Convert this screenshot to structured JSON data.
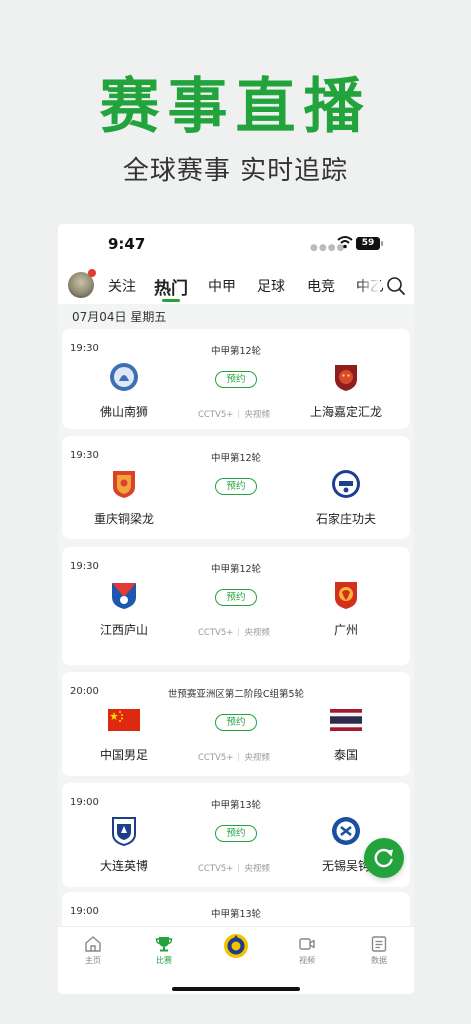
{
  "promo": {
    "title": "赛事直播",
    "subtitle": "全球赛事 实时追踪"
  },
  "status_bar": {
    "time": "9:47",
    "battery": "59"
  },
  "tabs": [
    "关注",
    "热门",
    "中甲",
    "足球",
    "电竞",
    "中乙"
  ],
  "active_tab": "热门",
  "date_header": "07月04日 星期五",
  "matches": [
    {
      "time": "19:30",
      "competition": "中甲第12轮",
      "home": "佛山南狮",
      "away": "上海嘉定汇龙",
      "action": "预约",
      "channels": [
        "CCTV5+",
        "央视频"
      ]
    },
    {
      "time": "19:30",
      "competition": "中甲第12轮",
      "home": "重庆铜梁龙",
      "away": "石家庄功夫",
      "action": "预约",
      "channels": []
    },
    {
      "time": "19:30",
      "competition": "中甲第12轮",
      "home": "江西庐山",
      "away": "广州",
      "action": "预约",
      "channels": [
        "CCTV5+",
        "央视频"
      ]
    },
    {
      "time": "20:00",
      "competition": "世预赛亚洲区第二阶段C组第5轮",
      "home": "中国男足",
      "away": "泰国",
      "action": "预约",
      "channels": [
        "CCTV5+",
        "央视频"
      ]
    },
    {
      "time": "19:00",
      "competition": "中甲第13轮",
      "home": "大连英博",
      "away": "无锡吴钩",
      "action": "预约",
      "channels": [
        "CCTV5+",
        "央视频"
      ]
    },
    {
      "time": "19:00",
      "competition": "中甲第13轮",
      "home": "",
      "away": "",
      "action": "",
      "channels": []
    }
  ],
  "bottom_nav": [
    {
      "label": "主页",
      "icon": "home-icon"
    },
    {
      "label": "比赛",
      "icon": "trophy-icon"
    },
    {
      "label": "",
      "icon": "club-badge-icon"
    },
    {
      "label": "视频",
      "icon": "video-icon"
    },
    {
      "label": "数据",
      "icon": "data-icon"
    }
  ],
  "colors": {
    "accent": "#22a33c",
    "background": "#eff1f0"
  }
}
